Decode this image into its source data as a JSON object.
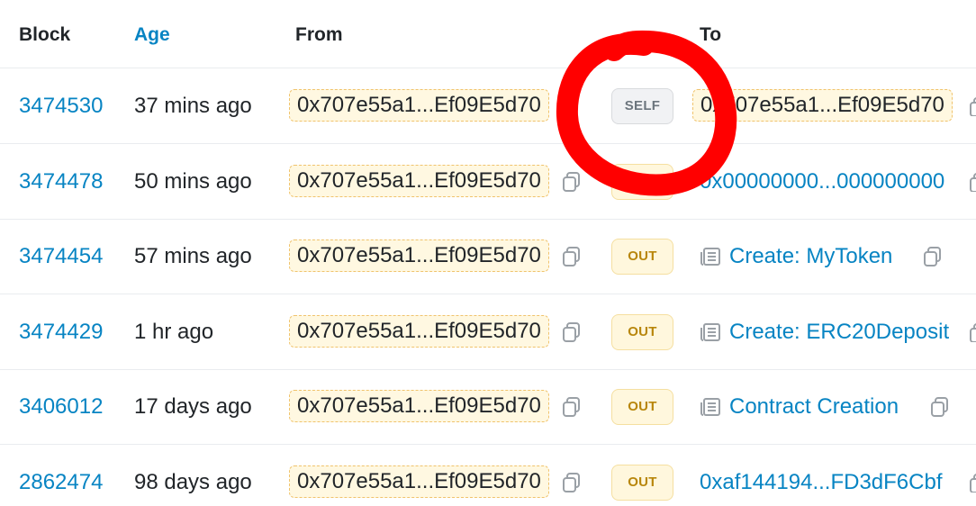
{
  "header": {
    "block": "Block",
    "age": "Age",
    "from": "From",
    "to": "To"
  },
  "rows": [
    {
      "block": "3474530",
      "age": "37 mins ago",
      "from": "0x707e55a1...Ef09E5d70",
      "direction": "SELF",
      "to": "0x707e55a1...Ef09E5d70",
      "to_type": "address-highlighted"
    },
    {
      "block": "3474478",
      "age": "50 mins ago",
      "from": "0x707e55a1...Ef09E5d70",
      "direction": "OUT",
      "to": "0x00000000...000000000",
      "to_type": "address"
    },
    {
      "block": "3474454",
      "age": "57 mins ago",
      "from": "0x707e55a1...Ef09E5d70",
      "direction": "OUT",
      "to": "Create: MyToken",
      "to_type": "contract"
    },
    {
      "block": "3474429",
      "age": "1 hr ago",
      "from": "0x707e55a1...Ef09E5d70",
      "direction": "OUT",
      "to": "Create: ERC20Deposit",
      "to_type": "contract"
    },
    {
      "block": "3406012",
      "age": "17 days ago",
      "from": "0x707e55a1...Ef09E5d70",
      "direction": "OUT",
      "to": "Contract Creation",
      "to_type": "contract"
    },
    {
      "block": "2862474",
      "age": "98 days ago",
      "from": "0x707e55a1...Ef09E5d70",
      "direction": "OUT",
      "to": "0xaf144194...FD3dF6Cbf",
      "to_type": "address"
    }
  ],
  "icons": {
    "copy": "copy-icon",
    "contract": "contract-document-icon"
  },
  "colors": {
    "link": "#0784c3",
    "highlight_bg": "#fff8e1",
    "highlight_border": "#f0c36d",
    "out_badge": "#b8860b",
    "annotation": "#ff0000"
  },
  "annotation": "red-hand-drawn-circle-around-self-badge"
}
